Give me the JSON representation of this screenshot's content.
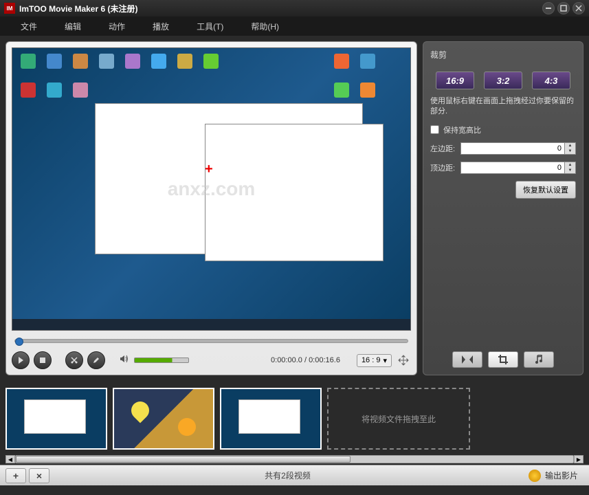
{
  "titlebar": {
    "title": "ImTOO Movie Maker 6 (未注册)"
  },
  "menubar": {
    "file": "文件",
    "edit": "编辑",
    "action": "动作",
    "play": "播放",
    "tools": "工具(T)",
    "help": "帮助(H)"
  },
  "watermark": "anxz.com",
  "controls": {
    "time_current": "0:00:00.0",
    "time_total": "0:00:16.6",
    "ratio_display": "16 : 9"
  },
  "rightpanel": {
    "title": "裁剪",
    "ratio_169": "16:9",
    "ratio_32": "3:2",
    "ratio_43": "4:3",
    "desc": "使用鼠标右键在画面上拖拽经过你要保留的部分.",
    "keep_aspect": "保持宽高比",
    "left_margin_label": "左边距:",
    "left_margin_value": "0",
    "top_margin_label": "顶边距:",
    "top_margin_value": "0",
    "restore": "恢复默认设置"
  },
  "timeline": {
    "dropzone": "将视频文件拖拽至此"
  },
  "bottombar": {
    "status": "共有2段视频",
    "export": "输出影片",
    "add": "+",
    "remove": "×"
  }
}
